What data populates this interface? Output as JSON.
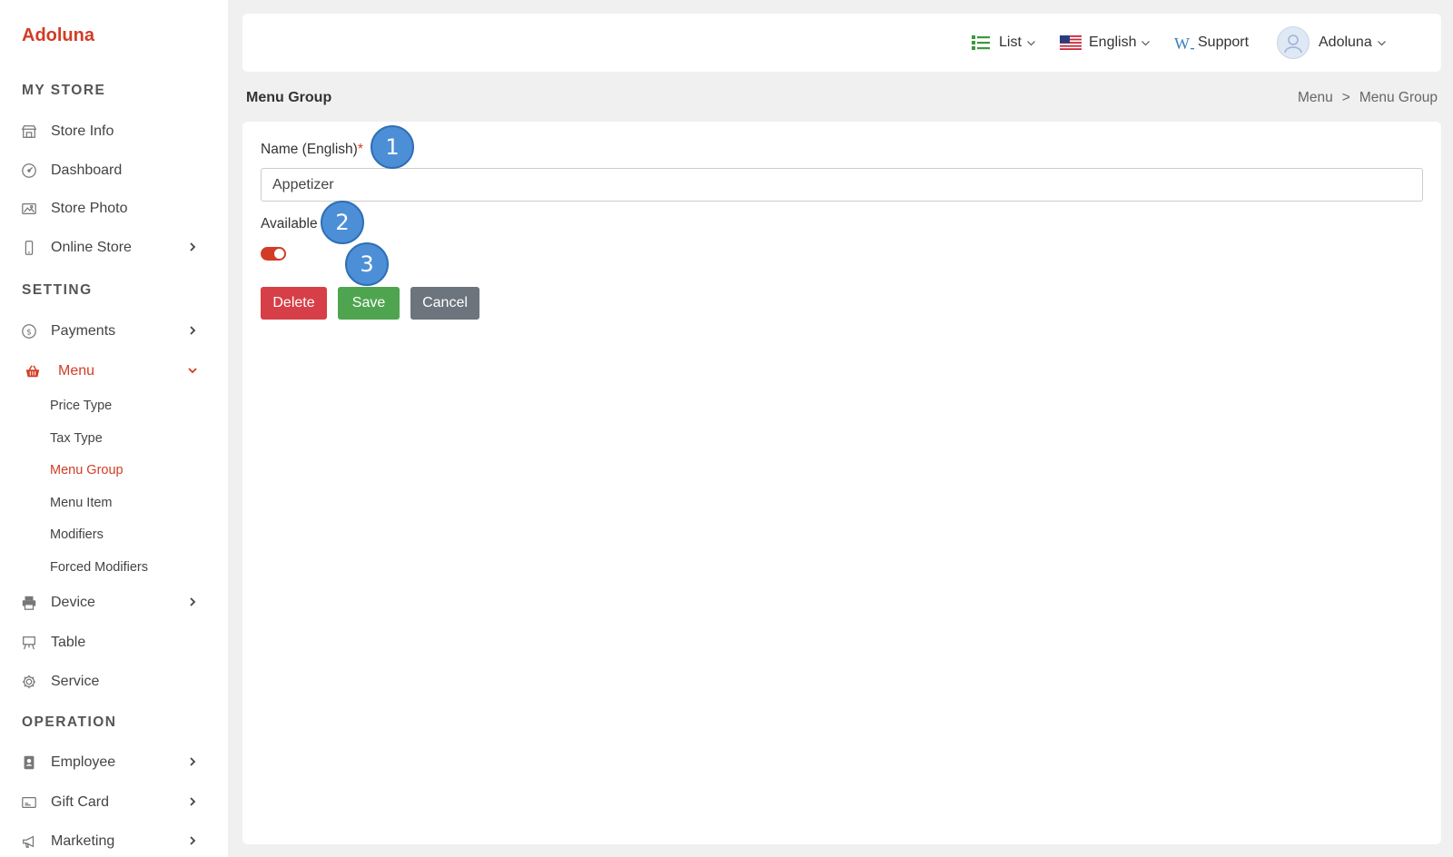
{
  "brand": "Adoluna",
  "sidebar": {
    "sections": [
      {
        "title": "MY STORE"
      },
      {
        "title": "SETTING"
      },
      {
        "title": "OPERATION"
      }
    ],
    "my_store": [
      {
        "label": "Store Info",
        "icon": "store-icon"
      },
      {
        "label": "Dashboard",
        "icon": "dashboard-icon"
      },
      {
        "label": "Store Photo",
        "icon": "photo-icon"
      },
      {
        "label": "Online Store",
        "icon": "phone-icon",
        "expandable": true
      }
    ],
    "setting": [
      {
        "label": "Payments",
        "icon": "dollar-icon",
        "expandable": true
      },
      {
        "label": "Menu",
        "icon": "basket-icon",
        "active": true,
        "expanded": true
      },
      {
        "label": "Device",
        "icon": "printer-icon",
        "expandable": true
      },
      {
        "label": "Table",
        "icon": "table-icon"
      },
      {
        "label": "Service",
        "icon": "gear-icon"
      }
    ],
    "menu_sub": [
      {
        "label": "Price Type"
      },
      {
        "label": "Tax Type"
      },
      {
        "label": "Menu Group",
        "active": true
      },
      {
        "label": "Menu Item"
      },
      {
        "label": "Modifiers"
      },
      {
        "label": "Forced Modifiers"
      }
    ],
    "operation": [
      {
        "label": "Employee",
        "icon": "badge-icon",
        "expandable": true
      },
      {
        "label": "Gift Card",
        "icon": "card-icon",
        "expandable": true
      },
      {
        "label": "Marketing",
        "icon": "megaphone-icon",
        "expandable": true
      }
    ]
  },
  "topbar": {
    "list_label": "List",
    "language_label": "English",
    "support_label": "Support",
    "user_label": "Adoluna"
  },
  "page": {
    "title": "Menu Group",
    "breadcrumb": [
      "Menu",
      ">",
      "Menu Group"
    ]
  },
  "form": {
    "name_label": "Name (English)",
    "name_required": "*",
    "name_value": "Appetizer",
    "available_label": "Available",
    "available_on": true,
    "delete_label": "Delete",
    "save_label": "Save",
    "cancel_label": "Cancel"
  },
  "markers": [
    "1",
    "2",
    "3"
  ],
  "colors": {
    "brand": "#d23c25",
    "save": "#4fa54f",
    "delete": "#d63f47",
    "cancel": "#6c757d",
    "marker": "#4d8fd6"
  }
}
